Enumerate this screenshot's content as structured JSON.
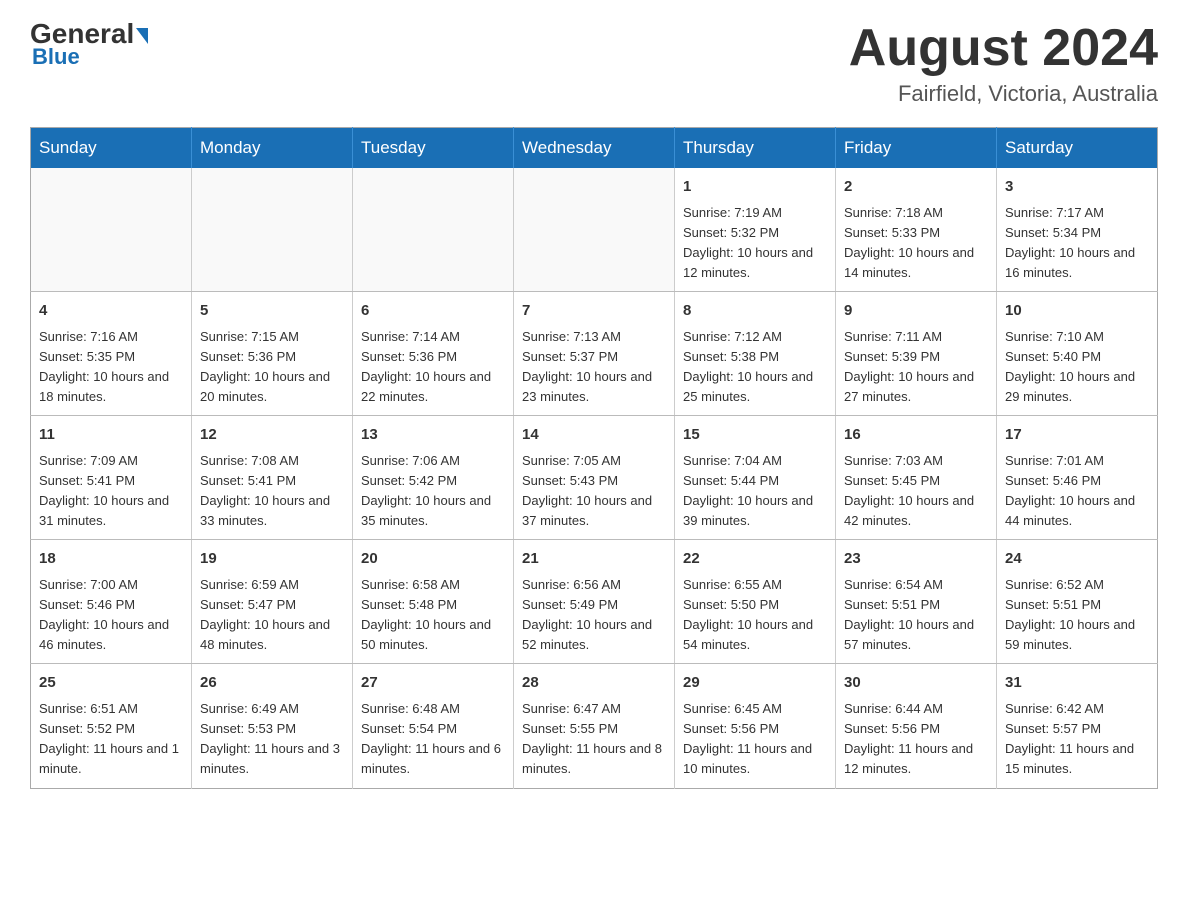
{
  "logo": {
    "general": "General",
    "triangle": "",
    "blue": "Blue"
  },
  "title": "August 2024",
  "location": "Fairfield, Victoria, Australia",
  "days_of_week": [
    "Sunday",
    "Monday",
    "Tuesday",
    "Wednesday",
    "Thursday",
    "Friday",
    "Saturday"
  ],
  "weeks": [
    [
      {
        "day": "",
        "info": ""
      },
      {
        "day": "",
        "info": ""
      },
      {
        "day": "",
        "info": ""
      },
      {
        "day": "",
        "info": ""
      },
      {
        "day": "1",
        "info": "Sunrise: 7:19 AM\nSunset: 5:32 PM\nDaylight: 10 hours and 12 minutes."
      },
      {
        "day": "2",
        "info": "Sunrise: 7:18 AM\nSunset: 5:33 PM\nDaylight: 10 hours and 14 minutes."
      },
      {
        "day": "3",
        "info": "Sunrise: 7:17 AM\nSunset: 5:34 PM\nDaylight: 10 hours and 16 minutes."
      }
    ],
    [
      {
        "day": "4",
        "info": "Sunrise: 7:16 AM\nSunset: 5:35 PM\nDaylight: 10 hours and 18 minutes."
      },
      {
        "day": "5",
        "info": "Sunrise: 7:15 AM\nSunset: 5:36 PM\nDaylight: 10 hours and 20 minutes."
      },
      {
        "day": "6",
        "info": "Sunrise: 7:14 AM\nSunset: 5:36 PM\nDaylight: 10 hours and 22 minutes."
      },
      {
        "day": "7",
        "info": "Sunrise: 7:13 AM\nSunset: 5:37 PM\nDaylight: 10 hours and 23 minutes."
      },
      {
        "day": "8",
        "info": "Sunrise: 7:12 AM\nSunset: 5:38 PM\nDaylight: 10 hours and 25 minutes."
      },
      {
        "day": "9",
        "info": "Sunrise: 7:11 AM\nSunset: 5:39 PM\nDaylight: 10 hours and 27 minutes."
      },
      {
        "day": "10",
        "info": "Sunrise: 7:10 AM\nSunset: 5:40 PM\nDaylight: 10 hours and 29 minutes."
      }
    ],
    [
      {
        "day": "11",
        "info": "Sunrise: 7:09 AM\nSunset: 5:41 PM\nDaylight: 10 hours and 31 minutes."
      },
      {
        "day": "12",
        "info": "Sunrise: 7:08 AM\nSunset: 5:41 PM\nDaylight: 10 hours and 33 minutes."
      },
      {
        "day": "13",
        "info": "Sunrise: 7:06 AM\nSunset: 5:42 PM\nDaylight: 10 hours and 35 minutes."
      },
      {
        "day": "14",
        "info": "Sunrise: 7:05 AM\nSunset: 5:43 PM\nDaylight: 10 hours and 37 minutes."
      },
      {
        "day": "15",
        "info": "Sunrise: 7:04 AM\nSunset: 5:44 PM\nDaylight: 10 hours and 39 minutes."
      },
      {
        "day": "16",
        "info": "Sunrise: 7:03 AM\nSunset: 5:45 PM\nDaylight: 10 hours and 42 minutes."
      },
      {
        "day": "17",
        "info": "Sunrise: 7:01 AM\nSunset: 5:46 PM\nDaylight: 10 hours and 44 minutes."
      }
    ],
    [
      {
        "day": "18",
        "info": "Sunrise: 7:00 AM\nSunset: 5:46 PM\nDaylight: 10 hours and 46 minutes."
      },
      {
        "day": "19",
        "info": "Sunrise: 6:59 AM\nSunset: 5:47 PM\nDaylight: 10 hours and 48 minutes."
      },
      {
        "day": "20",
        "info": "Sunrise: 6:58 AM\nSunset: 5:48 PM\nDaylight: 10 hours and 50 minutes."
      },
      {
        "day": "21",
        "info": "Sunrise: 6:56 AM\nSunset: 5:49 PM\nDaylight: 10 hours and 52 minutes."
      },
      {
        "day": "22",
        "info": "Sunrise: 6:55 AM\nSunset: 5:50 PM\nDaylight: 10 hours and 54 minutes."
      },
      {
        "day": "23",
        "info": "Sunrise: 6:54 AM\nSunset: 5:51 PM\nDaylight: 10 hours and 57 minutes."
      },
      {
        "day": "24",
        "info": "Sunrise: 6:52 AM\nSunset: 5:51 PM\nDaylight: 10 hours and 59 minutes."
      }
    ],
    [
      {
        "day": "25",
        "info": "Sunrise: 6:51 AM\nSunset: 5:52 PM\nDaylight: 11 hours and 1 minute."
      },
      {
        "day": "26",
        "info": "Sunrise: 6:49 AM\nSunset: 5:53 PM\nDaylight: 11 hours and 3 minutes."
      },
      {
        "day": "27",
        "info": "Sunrise: 6:48 AM\nSunset: 5:54 PM\nDaylight: 11 hours and 6 minutes."
      },
      {
        "day": "28",
        "info": "Sunrise: 6:47 AM\nSunset: 5:55 PM\nDaylight: 11 hours and 8 minutes."
      },
      {
        "day": "29",
        "info": "Sunrise: 6:45 AM\nSunset: 5:56 PM\nDaylight: 11 hours and 10 minutes."
      },
      {
        "day": "30",
        "info": "Sunrise: 6:44 AM\nSunset: 5:56 PM\nDaylight: 11 hours and 12 minutes."
      },
      {
        "day": "31",
        "info": "Sunrise: 6:42 AM\nSunset: 5:57 PM\nDaylight: 11 hours and 15 minutes."
      }
    ]
  ]
}
